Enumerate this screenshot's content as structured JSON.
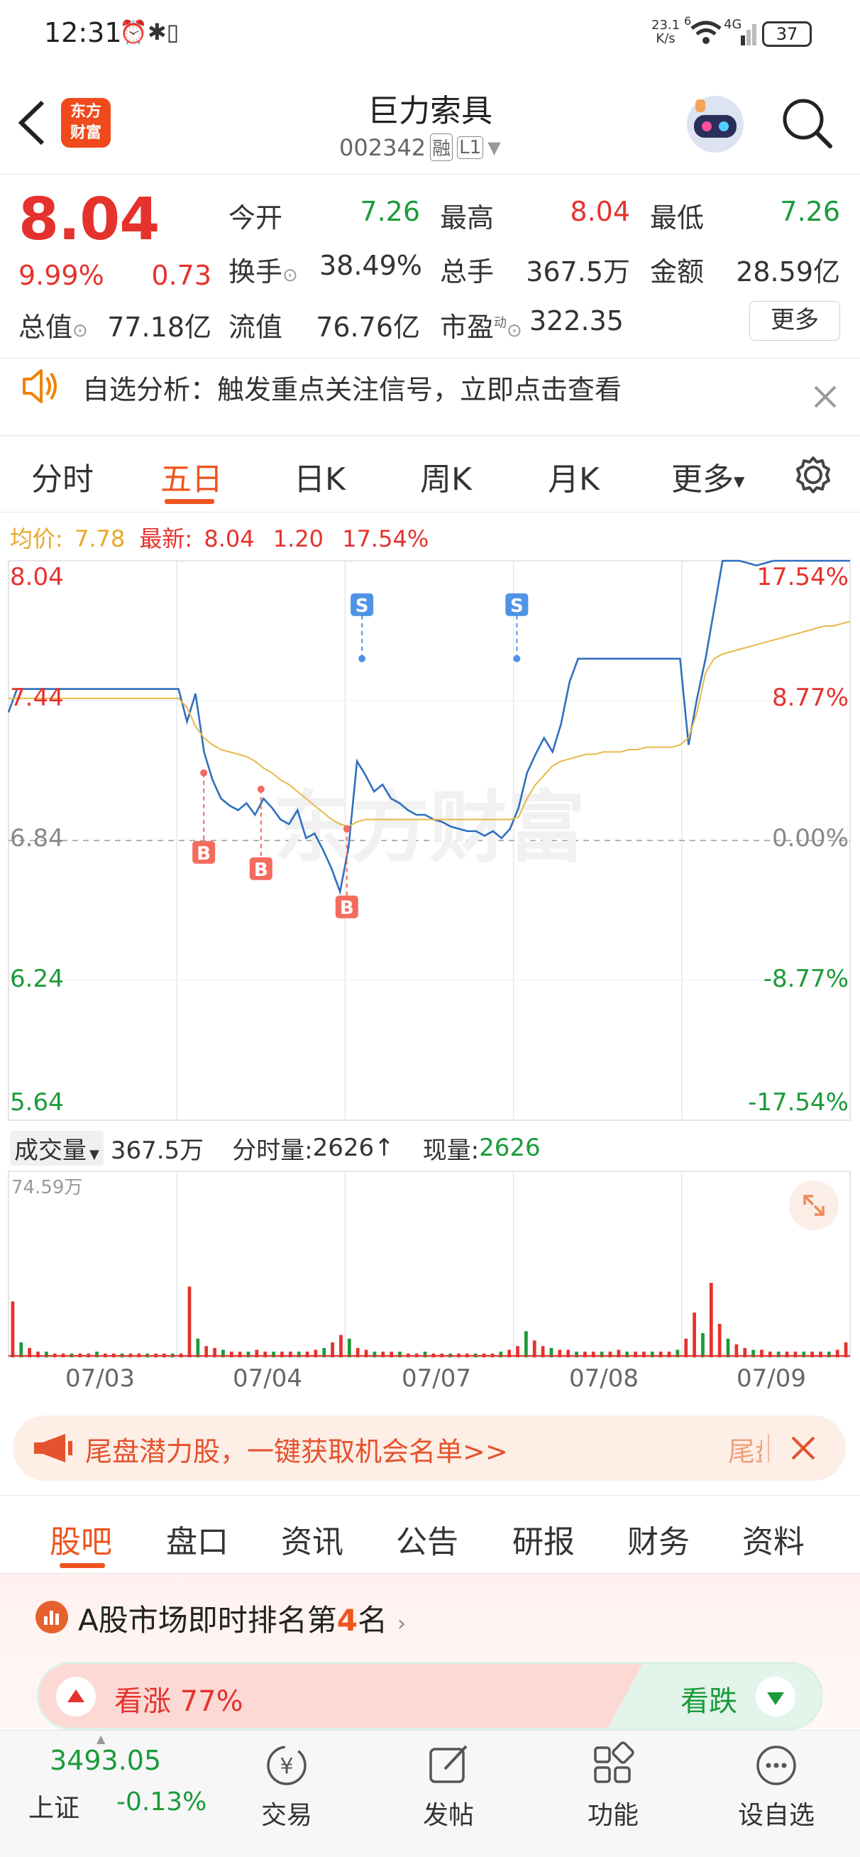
{
  "status": {
    "time": "12:31",
    "net_speed_value": "23.1",
    "net_speed_unit": "K/s",
    "signal": "4G",
    "battery": "37",
    "sim_label": "6"
  },
  "header": {
    "brand_line1": "东方",
    "brand_line2": "财富",
    "title": "巨力索具",
    "code": "002342",
    "tag1": "融",
    "tag2": "L1"
  },
  "quote": {
    "price": "8.04",
    "change_pct": "9.99%",
    "change_amt": "0.73",
    "open_label": "今开",
    "open": "7.26",
    "high_label": "最高",
    "high": "8.04",
    "low_label": "最低",
    "low": "7.26",
    "turnover_label": "换手",
    "turnover": "38.49%",
    "volume_label": "总手",
    "volume": "367.5万",
    "amount_label": "金额",
    "amount": "28.59亿",
    "mktcap_label": "总值",
    "mktcap": "77.18亿",
    "float_label": "流值",
    "float_cap": "76.76亿",
    "pe_label": "市盈",
    "pe_sup": "动",
    "pe": "322.35",
    "more_button": "更多"
  },
  "notice": {
    "text": "自选分析：触发重点关注信号，立即点击查看"
  },
  "chart_tabs": [
    "分时",
    "五日",
    "日K",
    "周K",
    "月K",
    "更多"
  ],
  "chart_tabs_active": "五日",
  "legend": {
    "avg_label": "均价:",
    "avg": "7.78",
    "latest_label": "最新:",
    "latest": "8.04",
    "chg": "1.20",
    "chg_pct": "17.54%"
  },
  "watermark": "东方财富",
  "chart_data": {
    "type": "line",
    "x": [
      "07/03",
      "07/04",
      "07/07",
      "07/08",
      "07/09"
    ],
    "y_left_ticks": [
      "8.04",
      "7.44",
      "6.84",
      "6.24",
      "5.64"
    ],
    "y_right_ticks": [
      "17.54%",
      "8.77%",
      "0.00%",
      "-8.77%",
      "-17.54%"
    ],
    "ylim": [
      5.64,
      8.04
    ],
    "base_price": 6.84,
    "series": [
      {
        "name": "最新",
        "color": "#2f6fbf",
        "values": [
          7.39,
          7.49,
          7.49,
          7.49,
          7.49,
          7.49,
          7.49,
          7.49,
          7.49,
          7.49,
          7.49,
          7.49,
          7.49,
          7.49,
          7.49,
          7.49,
          7.49,
          7.49,
          7.49,
          7.49,
          7.49,
          7.35,
          7.47,
          7.22,
          7.1,
          7.02,
          6.99,
          6.97,
          7.0,
          6.95,
          7.02,
          6.98,
          6.93,
          6.91,
          6.97,
          6.85,
          6.87,
          6.8,
          6.72,
          6.62,
          6.81,
          7.18,
          7.12,
          7.05,
          7.08,
          7.02,
          7.0,
          6.97,
          6.95,
          6.95,
          6.93,
          6.92,
          6.9,
          6.89,
          6.88,
          6.88,
          6.86,
          6.88,
          6.85,
          6.89,
          6.98,
          7.13,
          7.21,
          7.28,
          7.22,
          7.34,
          7.52,
          7.62,
          7.62,
          7.62,
          7.62,
          7.62,
          7.62,
          7.62,
          7.62,
          7.62,
          7.62,
          7.62,
          7.62,
          7.62,
          7.25,
          7.45,
          7.62,
          7.83,
          8.04,
          8.04,
          8.04,
          8.03,
          8.02,
          8.03,
          8.04,
          8.04,
          8.04,
          8.04,
          8.04,
          8.04,
          8.04,
          8.04,
          8.04,
          8.04
        ]
      },
      {
        "name": "均价",
        "color": "#e8b84a",
        "values": [
          7.45,
          7.45,
          7.45,
          7.45,
          7.45,
          7.45,
          7.45,
          7.45,
          7.45,
          7.45,
          7.45,
          7.45,
          7.45,
          7.45,
          7.45,
          7.45,
          7.45,
          7.45,
          7.45,
          7.45,
          7.45,
          7.41,
          7.33,
          7.28,
          7.25,
          7.23,
          7.22,
          7.21,
          7.2,
          7.18,
          7.15,
          7.13,
          7.1,
          7.08,
          7.05,
          7.02,
          6.99,
          6.96,
          6.93,
          6.91,
          6.9,
          6.92,
          6.93,
          6.93,
          6.93,
          6.93,
          6.93,
          6.93,
          6.93,
          6.93,
          6.93,
          6.93,
          6.93,
          6.93,
          6.93,
          6.93,
          6.93,
          6.93,
          6.93,
          6.93,
          6.94,
          7.02,
          7.08,
          7.12,
          7.16,
          7.18,
          7.19,
          7.2,
          7.21,
          7.21,
          7.22,
          7.22,
          7.22,
          7.23,
          7.23,
          7.24,
          7.24,
          7.24,
          7.24,
          7.25,
          7.28,
          7.39,
          7.56,
          7.62,
          7.64,
          7.65,
          7.66,
          7.67,
          7.68,
          7.69,
          7.7,
          7.71,
          7.72,
          7.73,
          7.74,
          7.75,
          7.76,
          7.76,
          7.77,
          7.78
        ]
      }
    ],
    "signals": [
      {
        "label": "B",
        "day": 1.16,
        "price": 7.13
      },
      {
        "label": "B",
        "day": 1.5,
        "price": 7.06
      },
      {
        "label": "B",
        "day": 2.01,
        "price": 6.89
      },
      {
        "label": "S",
        "day": 2.1,
        "price": 7.62
      },
      {
        "label": "S",
        "day": 3.02,
        "price": 7.62
      }
    ]
  },
  "volume_bar": {
    "label": "成交量",
    "total": "367.5万",
    "minute_label": "分时量:",
    "minute": "2626",
    "arrow": "↑",
    "now_label": "现量:",
    "now": "2626",
    "max": "74.59万"
  },
  "volume_chart": {
    "values": [
      30,
      8,
      5,
      3,
      3,
      2,
      2,
      2,
      2,
      2,
      3,
      2,
      2,
      2,
      2,
      2,
      2,
      2,
      2,
      2,
      2,
      38,
      10,
      6,
      5,
      4,
      3,
      3,
      3,
      4,
      3,
      3,
      3,
      3,
      3,
      3,
      4,
      5,
      8,
      12,
      10,
      5,
      4,
      3,
      3,
      3,
      3,
      2,
      2,
      3,
      2,
      2,
      2,
      2,
      2,
      2,
      2,
      2,
      3,
      4,
      6,
      14,
      9,
      6,
      5,
      4,
      4,
      3,
      3,
      3,
      3,
      3,
      4,
      3,
      3,
      3,
      3,
      3,
      3,
      4,
      10,
      24,
      13,
      40,
      18,
      10,
      7,
      5,
      4,
      4,
      3,
      3,
      3,
      3,
      3,
      3,
      3,
      3,
      4,
      8
    ],
    "colors_up": "#e5322d",
    "colors_down": "#1a9b3a"
  },
  "promo": {
    "text": "尾盘潜力股，一键获取机会名单>>",
    "tail": "尾盘"
  },
  "bottom_tabs": [
    "股吧",
    "盘口",
    "资讯",
    "公告",
    "研报",
    "财务",
    "资料"
  ],
  "bottom_tabs_active": "股吧",
  "ranking": {
    "prefix": "A股市场即时排名第",
    "rank": "4",
    "suffix": "名"
  },
  "sentiment": {
    "bull_label": "看涨 77%",
    "bear_label": "看跌"
  },
  "nav": {
    "index_value": "3493.05",
    "index_name": "上证",
    "index_chg": "-0.13%",
    "items": [
      "交易",
      "发帖",
      "功能",
      "设自选"
    ]
  }
}
